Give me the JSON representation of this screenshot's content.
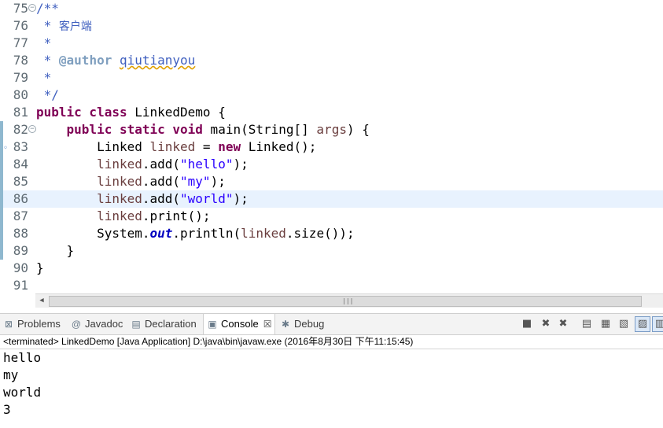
{
  "editor": {
    "lines": [
      {
        "num": "75"
      },
      {
        "num": "76"
      },
      {
        "num": "77"
      },
      {
        "num": "78"
      },
      {
        "num": "79"
      },
      {
        "num": "80"
      },
      {
        "num": "81"
      },
      {
        "num": "82"
      },
      {
        "num": "83"
      },
      {
        "num": "84"
      },
      {
        "num": "85"
      },
      {
        "num": "86"
      },
      {
        "num": "87"
      },
      {
        "num": "88"
      },
      {
        "num": "89"
      },
      {
        "num": "90"
      },
      {
        "num": "91"
      }
    ],
    "tokens": {
      "l75": "/**",
      "l76_star": " * ",
      "l76_text": "客户端",
      "l77": " *",
      "l78_star": " * ",
      "l78_tag": "@author",
      "l78_sp": " ",
      "l78_name": "qiutianyou",
      "l79": " *",
      "l80": " */",
      "l81_kw": "public class",
      "l81_rest": " LinkedDemo {",
      "l82_ind": "    ",
      "l82_kw": "public static void",
      "l82_mid": " main(String[] ",
      "l82_var": "args",
      "l82_end": ") {",
      "l83_pre": "        Linked ",
      "l83_var": "linked",
      "l83_eq": " = ",
      "l83_kw": "new",
      "l83_end": " Linked();",
      "ind8": "        ",
      "linked": "linked",
      "add_open": ".add(",
      "close_paren": ");",
      "l84_str": "\"hello\"",
      "l85_str": "\"my\"",
      "l86_str": "\"world\"",
      "l87_rest": ".print();",
      "l88_pre": "System.",
      "l88_fld": "out",
      "l88_mid": ".println(",
      "l88_end": ".size());",
      "l89": "    }",
      "l90": "}"
    }
  },
  "tabs": {
    "problems": "Problems",
    "javadoc": "Javadoc",
    "declaration": "Declaration",
    "console": "Console",
    "console_close": "☒",
    "debug": "Debug"
  },
  "console": {
    "status": "<terminated> LinkedDemo [Java Application] D:\\java\\bin\\javaw.exe (2016年8月30日 下午11:15:45)",
    "output": [
      "hello",
      "my",
      "world",
      "3"
    ]
  },
  "icons": {
    "problems": "problems-icon",
    "javadoc": "javadoc-icon",
    "declaration": "declaration-icon",
    "console": "console-icon",
    "debug": "debug-icon"
  }
}
